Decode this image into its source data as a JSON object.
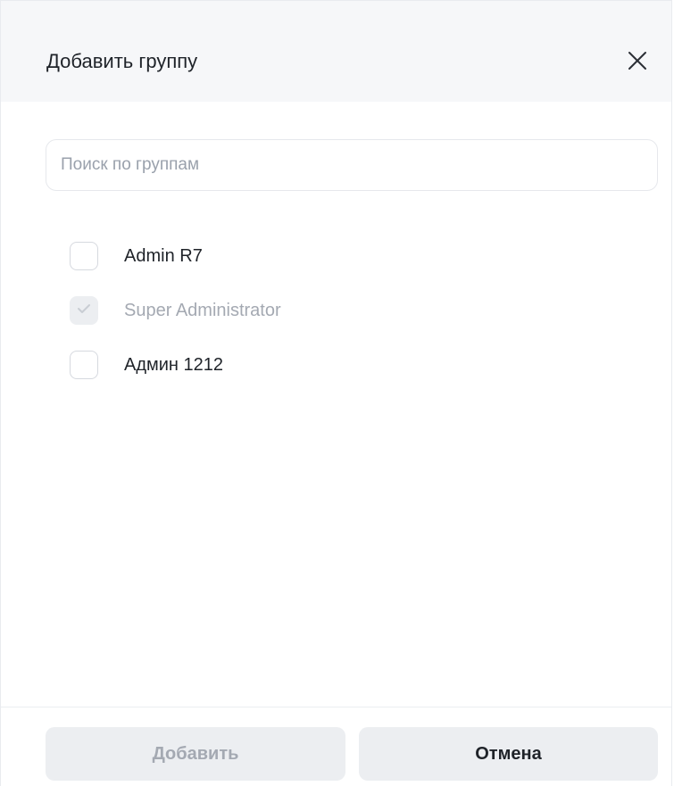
{
  "dialog": {
    "title": "Добавить группу",
    "close_icon": "close-icon"
  },
  "search": {
    "placeholder": "Поиск по группам",
    "value": ""
  },
  "groups": [
    {
      "label": "Admin R7",
      "checked": false,
      "disabled": false
    },
    {
      "label": "Super Administrator",
      "checked": true,
      "disabled": true
    },
    {
      "label": "Админ 1212",
      "checked": false,
      "disabled": false
    }
  ],
  "footer": {
    "add_label": "Добавить",
    "cancel_label": "Отмена"
  },
  "colors": {
    "header_bg": "#f6f7f9",
    "text": "#1f2329",
    "muted": "#a4a9b2",
    "button_bg": "#eceef1"
  }
}
